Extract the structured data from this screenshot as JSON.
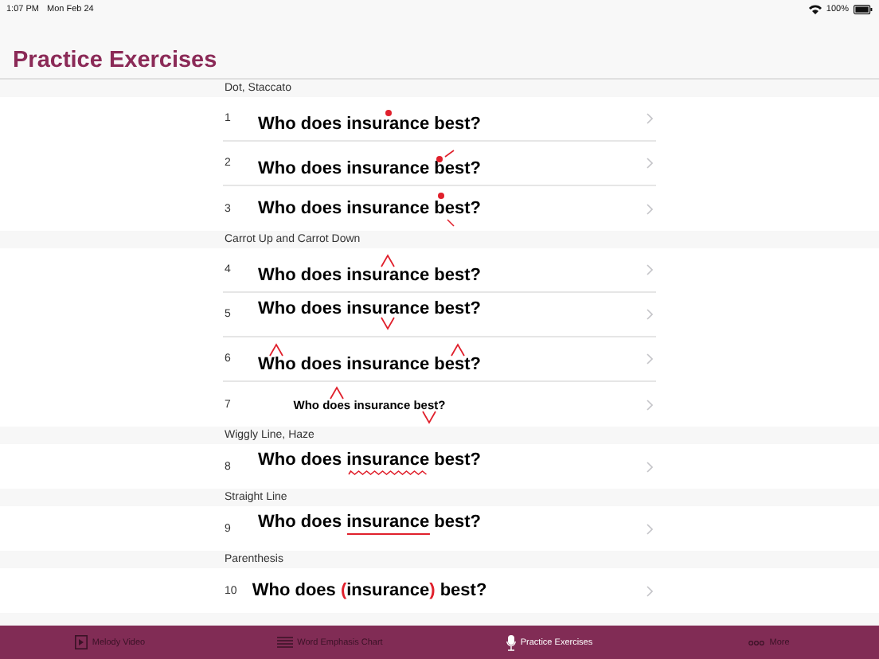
{
  "status_bar": {
    "time": "1:07 PM",
    "date": "Mon Feb 24",
    "battery": "100%"
  },
  "title": "Practice Exercises",
  "sections": [
    {
      "header": "Dot, Staccato",
      "rows": [
        {
          "number": "1",
          "kind": "normal",
          "segments": [
            {
              "kind": "plain",
              "text": "Who does "
            },
            {
              "kind": "dot-above",
              "text": "insurance"
            },
            {
              "kind": "plain",
              "text": " best?"
            }
          ]
        },
        {
          "number": "2",
          "kind": "normal",
          "segments": [
            {
              "kind": "plain",
              "text": "Who does insurance "
            },
            {
              "kind": "dot-rise",
              "text": "best?"
            }
          ]
        },
        {
          "number": "3",
          "kind": "normal",
          "segments": [
            {
              "kind": "plain",
              "text": "Who does insurance "
            },
            {
              "kind": "dot-fall",
              "text": "best?"
            }
          ]
        }
      ]
    },
    {
      "header": "Carrot Up and Carrot Down",
      "rows": [
        {
          "number": "4",
          "kind": "normal",
          "segments": [
            {
              "kind": "plain",
              "text": "Who does "
            },
            {
              "kind": "caret-up",
              "text": "insurance"
            },
            {
              "kind": "plain",
              "text": " best?"
            }
          ]
        },
        {
          "number": "5",
          "kind": "normal",
          "segments": [
            {
              "kind": "plain",
              "text": "Who does "
            },
            {
              "kind": "caret-down",
              "text": "insurance"
            },
            {
              "kind": "plain",
              "text": " best?"
            }
          ]
        },
        {
          "number": "6",
          "kind": "normal",
          "segments": [
            {
              "kind": "caret-up",
              "text": "Who"
            },
            {
              "kind": "plain",
              "text": " does insurance "
            },
            {
              "kind": "caret-up",
              "text": "best?"
            }
          ]
        },
        {
          "number": "7",
          "kind": "small",
          "segments": [
            {
              "kind": "plain",
              "text": "Who "
            },
            {
              "kind": "caret-up",
              "text": "does"
            },
            {
              "kind": "plain",
              "text": " insurance "
            },
            {
              "kind": "caret-down",
              "text": "best?"
            }
          ]
        }
      ]
    },
    {
      "header": "Wiggly Line, Haze",
      "rows": [
        {
          "number": "8",
          "kind": "normal",
          "segments": [
            {
              "kind": "plain",
              "text": "Who does "
            },
            {
              "kind": "wiggle-under",
              "text": "insurance"
            },
            {
              "kind": "plain",
              "text": " best?"
            }
          ]
        }
      ]
    },
    {
      "header": "Straight Line",
      "rows": [
        {
          "number": "9",
          "kind": "normal",
          "segments": [
            {
              "kind": "plain",
              "text": "Who does "
            },
            {
              "kind": "line-under",
              "text": "insurance"
            },
            {
              "kind": "plain",
              "text": " best?"
            }
          ]
        }
      ]
    },
    {
      "header": "Parenthesis",
      "rows": [
        {
          "number": "10",
          "kind": "normal",
          "segments": [
            {
              "kind": "plain",
              "text": "Who does "
            },
            {
              "kind": "paren",
              "text": "("
            },
            {
              "kind": "plain",
              "text": "insurance"
            },
            {
              "kind": "paren",
              "text": ")"
            },
            {
              "kind": "plain",
              "text": " best?"
            }
          ]
        }
      ]
    }
  ],
  "tabs": [
    {
      "label": "Melody Video",
      "kind": "video",
      "selected": false
    },
    {
      "label": "Word Emphasis Chart",
      "kind": "list",
      "selected": false
    },
    {
      "label": "Practice Exercises",
      "kind": "mic",
      "selected": true
    },
    {
      "label": "More",
      "kind": "more",
      "selected": false
    }
  ]
}
